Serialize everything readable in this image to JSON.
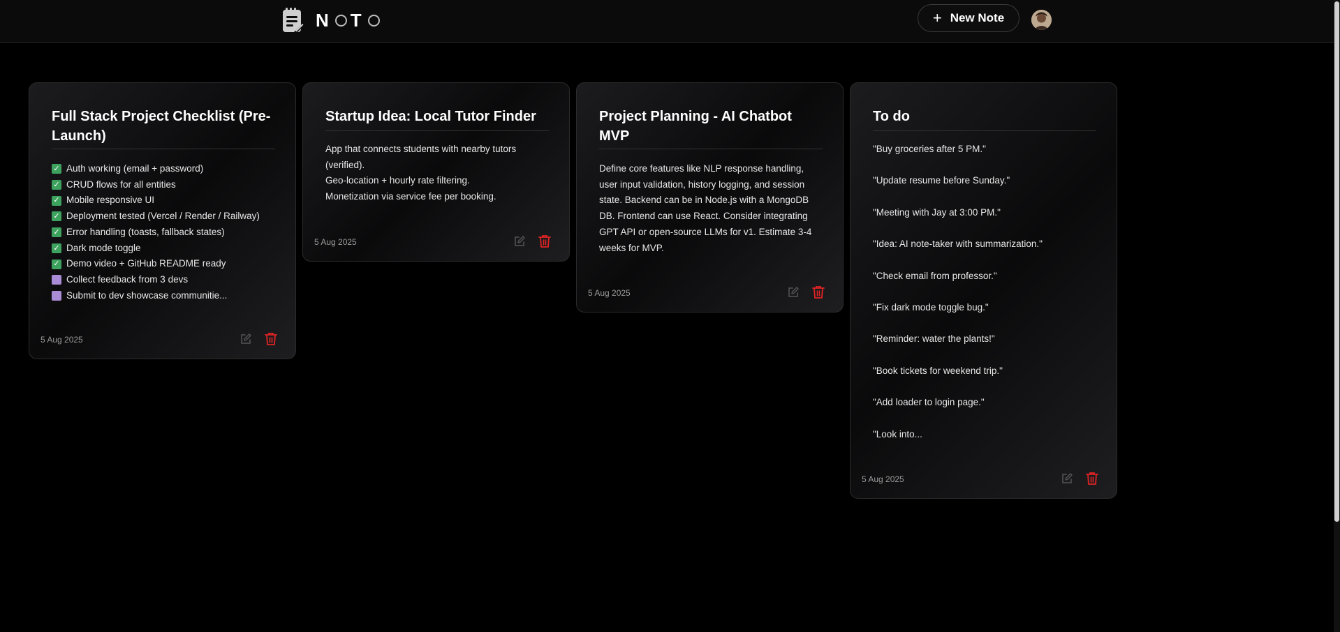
{
  "app": {
    "name": "NOTO",
    "logo_letters": [
      "N",
      "T"
    ]
  },
  "header": {
    "new_note_label": "New Note"
  },
  "colors": {
    "background": "#000000",
    "check_done": "#3ea25f",
    "check_todo": "#a98bd6",
    "delete": "#e02424",
    "edit": "#555555"
  },
  "notes": [
    {
      "title": "Full Stack Project Checklist (Pre-Launch)",
      "date": "5 Aug 2025",
      "checklist": [
        {
          "done": true,
          "text": "Auth working (email + password)"
        },
        {
          "done": true,
          "text": "CRUD flows for all entities"
        },
        {
          "done": true,
          "text": "Mobile responsive UI"
        },
        {
          "done": true,
          "text": "Deployment tested (Vercel / Render / Railway)"
        },
        {
          "done": true,
          "text": "Error handling (toasts, fallback states)"
        },
        {
          "done": true,
          "text": "Dark mode toggle"
        },
        {
          "done": true,
          "text": "Demo video + GitHub README ready"
        },
        {
          "done": false,
          "text": "Collect feedback from 3 devs"
        },
        {
          "done": false,
          "text": "Submit to dev showcase communitie..."
        }
      ]
    },
    {
      "title": "Startup Idea: Local Tutor Finder",
      "date": "5 Aug 2025",
      "lines": [
        "App that connects students with nearby tutors (verified).",
        "Geo-location + hourly rate filtering.",
        "Monetization via service fee per booking."
      ]
    },
    {
      "title": "Project Planning - AI Chatbot MVP",
      "date": "5 Aug 2025",
      "text": "Define core features like NLP response handling, user input validation, history logging, and session state. Backend can be in Node.js with a MongoDB DB. Frontend can use React. Consider integrating GPT API or open-source LLMs for v1. Estimate 3-4 weeks for MVP."
    },
    {
      "title": "To do",
      "date": "5 Aug 2025",
      "lines": [
        "\"Buy groceries after 5 PM.\"",
        "\"Update resume before Sunday.\"",
        "\"Meeting with Jay at 3:00 PM.\"",
        "\"Idea: AI note-taker with summarization.\"",
        "\"Check email from professor.\"",
        "\"Fix dark mode toggle bug.\"",
        "\"Reminder: water the plants!\"",
        "\"Book tickets for weekend trip.\"",
        "\"Add loader to login page.\"",
        "\"Look into..."
      ]
    }
  ]
}
